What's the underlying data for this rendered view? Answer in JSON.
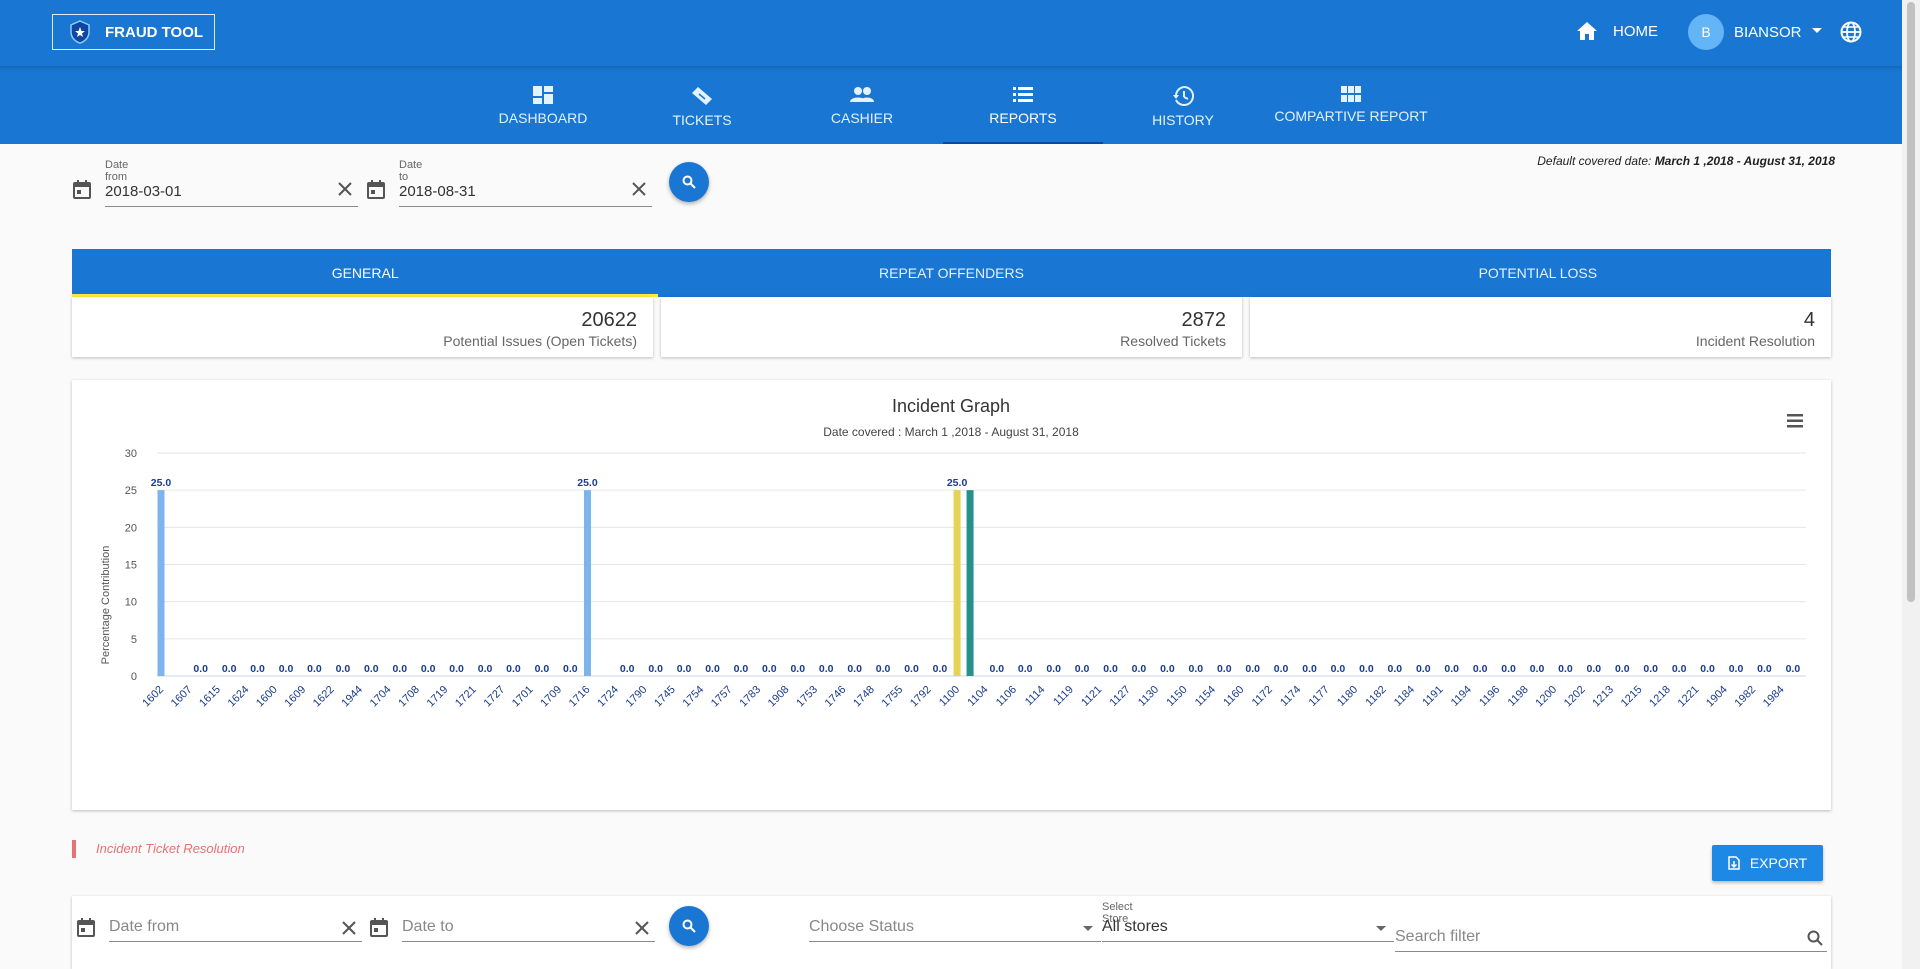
{
  "app": {
    "brand_label": "FRAUD TOOL",
    "home_label": "HOME",
    "user_initial": "B",
    "user_name": "BIANSOR"
  },
  "nav": {
    "tabs": [
      {
        "label": "DASHBOARD",
        "icon": "dashboard-icon"
      },
      {
        "label": "TICKETS",
        "icon": "ticket-icon"
      },
      {
        "label": "CASHIER",
        "icon": "people-icon"
      },
      {
        "label": "REPORTS",
        "icon": "list-icon",
        "active": true
      },
      {
        "label": "HISTORY",
        "icon": "history-icon"
      },
      {
        "label": "COMPARTIVE REPORT",
        "icon": "grid-icon"
      }
    ]
  },
  "filters": {
    "date_from_label": "Date from",
    "date_from_value": "2018-03-01",
    "date_to_label": "Date to",
    "date_to_value": "2018-08-31",
    "covered_prefix": "Default covered date:",
    "covered_range": "March 1 ,2018 - August 31, 2018"
  },
  "report_tabs": [
    {
      "label": "GENERAL",
      "active": true
    },
    {
      "label": "REPEAT OFFENDERS"
    },
    {
      "label": "POTENTIAL LOSS"
    }
  ],
  "stats": [
    {
      "value": "20622",
      "label": "Potential Issues (Open Tickets)"
    },
    {
      "value": "2872",
      "label": "Resolved Tickets"
    },
    {
      "value": "4",
      "label": "Incident Resolution"
    }
  ],
  "chart_data": {
    "type": "bar",
    "title": "Incident Graph",
    "subtitle": "Date covered : March 1 ,2018 - August 31, 2018",
    "ylabel": "Percentage Contribution",
    "xlabel": "",
    "ylim": [
      0,
      30
    ],
    "yticks": [
      0,
      5,
      10,
      15,
      20,
      25,
      30
    ],
    "grid": true,
    "categories": [
      "1602",
      "1607",
      "1615",
      "1624",
      "1600",
      "1609",
      "1622",
      "1944",
      "1704",
      "1708",
      "1719",
      "1721",
      "1727",
      "1701",
      "1709",
      "1716",
      "1724",
      "1790",
      "1745",
      "1754",
      "1757",
      "1783",
      "1908",
      "1753",
      "1746",
      "1748",
      "1755",
      "1792",
      "1100",
      "1104",
      "1106",
      "1114",
      "1119",
      "1121",
      "1127",
      "1130",
      "1150",
      "1154",
      "1160",
      "1172",
      "1174",
      "1177",
      "1180",
      "1182",
      "1184",
      "1191",
      "1194",
      "1196",
      "1198",
      "1200",
      "1202",
      "1213",
      "1215",
      "1218",
      "1221",
      "1904",
      "1982",
      "1984"
    ],
    "values": [
      25,
      0,
      0,
      0,
      0,
      0,
      0,
      0,
      0,
      0,
      0,
      0,
      0,
      0,
      0,
      25,
      0,
      0,
      0,
      0,
      0,
      0,
      0,
      0,
      0,
      0,
      0,
      0,
      25,
      0,
      0,
      0,
      0,
      0,
      0,
      0,
      0,
      0,
      0,
      0,
      0,
      0,
      0,
      0,
      0,
      0,
      0,
      0,
      0,
      0,
      0,
      0,
      0,
      0,
      0,
      0,
      0,
      0
    ],
    "extra_bars": [
      {
        "after_category": "1100",
        "value": 25,
        "color": "#26918a"
      }
    ],
    "bar_colors": {
      "default": "#7cb5ec",
      "1100": "#e4d354"
    },
    "value_label_color": "#1a3c8c",
    "menu_icon": "hamburger-menu-icon"
  },
  "resolution": {
    "title": "Incident Ticket Resolution",
    "export_label": "EXPORT",
    "date_from_placeholder": "Date from",
    "date_to_placeholder": "Date to",
    "status_placeholder": "Choose Status",
    "store_label": "Select Store",
    "store_value": "All stores",
    "search_placeholder": "Search filter"
  }
}
